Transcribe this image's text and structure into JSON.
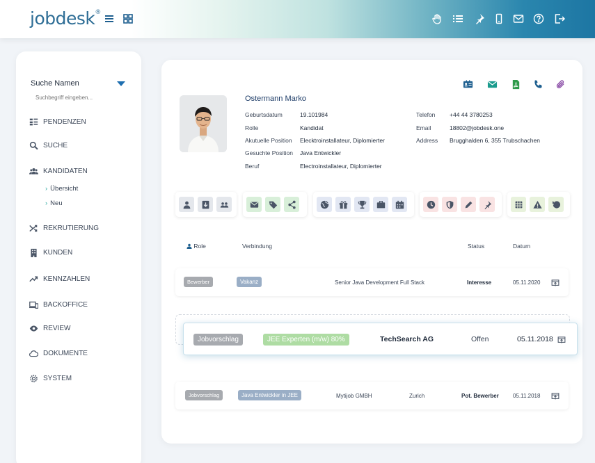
{
  "header": {
    "logo": "jobdesk",
    "logo_mark": "®"
  },
  "sidebar": {
    "search_title": "Suche Namen",
    "search_placeholder": "Suchbegriff eingeben...",
    "items": [
      {
        "label": "PENDENZEN",
        "icon": "list-icon"
      },
      {
        "label": "SUCHE",
        "icon": "search-icon"
      },
      {
        "label": "KANDIDATEN",
        "icon": "users-icon"
      },
      {
        "label": "REKRUTIERUNG",
        "icon": "shuffle-icon"
      },
      {
        "label": "KUNDEN",
        "icon": "building-icon"
      },
      {
        "label": "KENNZAHLEN",
        "icon": "trend-icon"
      },
      {
        "label": "BACKOFFICE",
        "icon": "devices-icon"
      },
      {
        "label": "REVIEW",
        "icon": "eye-icon"
      },
      {
        "label": "DOKUMENTE",
        "icon": "cloud-icon"
      },
      {
        "label": "SYSTEM",
        "icon": "gear-icon"
      }
    ],
    "subitems": [
      {
        "chev": "›",
        "label": "Übersicht"
      },
      {
        "chev": "›",
        "label": "Neu"
      }
    ]
  },
  "profile": {
    "name": "Ostermann Marko",
    "fields": [
      {
        "label": "Geburtsdatum",
        "value": "19.101984"
      },
      {
        "label": "Rolle",
        "value": "Kandidat"
      },
      {
        "label": "Akutuelle Position",
        "value": "Elecktroinstallateur, Diplomierter"
      },
      {
        "label": "Gesuchte Position",
        "value": "Java Entwickler"
      },
      {
        "label": "Beruf",
        "value": "Electroinstallateur, Diplomierter"
      }
    ],
    "contact": [
      {
        "label": "Telefon",
        "value": "+44 44 3780253"
      },
      {
        "label": "Email",
        "value": "18802@jobdesk.one"
      },
      {
        "label": "Address",
        "value": "Brugghalden 6, 355 Trubschachen"
      }
    ]
  },
  "table": {
    "headers": {
      "role": "Role",
      "verbindung": "Verbindung",
      "status": "Status",
      "datum": "Datum"
    },
    "rows": [
      {
        "role": "Bewerber",
        "tag": "Vakanz",
        "desc": "Senior Java Development Full Stack",
        "status": "Interesse",
        "date": "05.11.2020"
      },
      {
        "role": "Jobvorschlag",
        "tag": "Java Entwickler in JEE",
        "company": "Mytijob GMBH",
        "city": "Zurich",
        "status": "Pot. Bewerber",
        "date": "05.11.2018"
      }
    ],
    "drag_row": {
      "role": "Jobvorschlag",
      "tag": "JEE Experten (m/w) 80%",
      "company": "TechSearch AG",
      "status": "Offen",
      "date": "05.11.2018"
    }
  },
  "colors": {
    "accent": "#1e6fb0",
    "teal": "#2aa7a0"
  }
}
